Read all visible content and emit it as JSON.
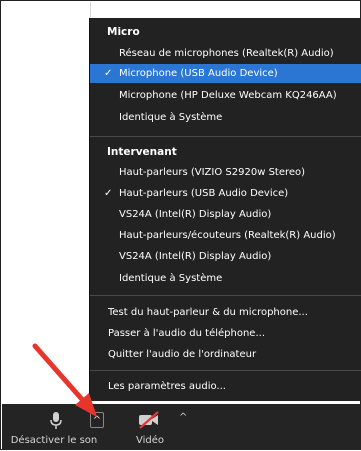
{
  "menu": {
    "micro": {
      "title": "Micro",
      "items": [
        {
          "label": "Réseau de microphones (Realtek(R) Audio)",
          "selected": false
        },
        {
          "label": "Microphone (USB Audio Device)",
          "selected": true
        },
        {
          "label": "Microphone (HP Deluxe Webcam KQ246AA)",
          "selected": false
        },
        {
          "label": "Identique à Système",
          "selected": false
        }
      ]
    },
    "speaker": {
      "title": "Intervenant",
      "items": [
        {
          "label": "Haut-parleurs (VIZIO S2920w Stereo)",
          "selected": false
        },
        {
          "label": "Haut-parleurs (USB Audio Device)",
          "selected": true
        },
        {
          "label": "VS24A (Intel(R) Display Audio)",
          "selected": false
        },
        {
          "label": "Haut-parleurs/écouteurs (Realtek(R) Audio)",
          "selected": false
        },
        {
          "label": "VS24A (Intel(R) Display Audio)",
          "selected": false
        },
        {
          "label": "Identique à Système",
          "selected": false
        }
      ]
    },
    "actions": [
      "Test du haut-parleur & du microphone...",
      "Passer à l'audio du téléphone...",
      "Quitter l'audio de l'ordinateur"
    ],
    "settings": "Les paramètres audio...",
    "check_glyph": "✓"
  },
  "toolbar": {
    "mute_label": "Désactiver le son",
    "video_label": "Vidéo",
    "caret_glyph": "^"
  },
  "colors": {
    "menu_bg": "#222222",
    "selected_bg": "#2a76d2",
    "arrow": "#e8352b",
    "toolbar_bg": "#242424",
    "video_off": "#e0383b"
  },
  "icons": [
    "microphone-icon",
    "video-off-icon",
    "check-icon",
    "caret-up-icon",
    "annotation-arrow"
  ]
}
